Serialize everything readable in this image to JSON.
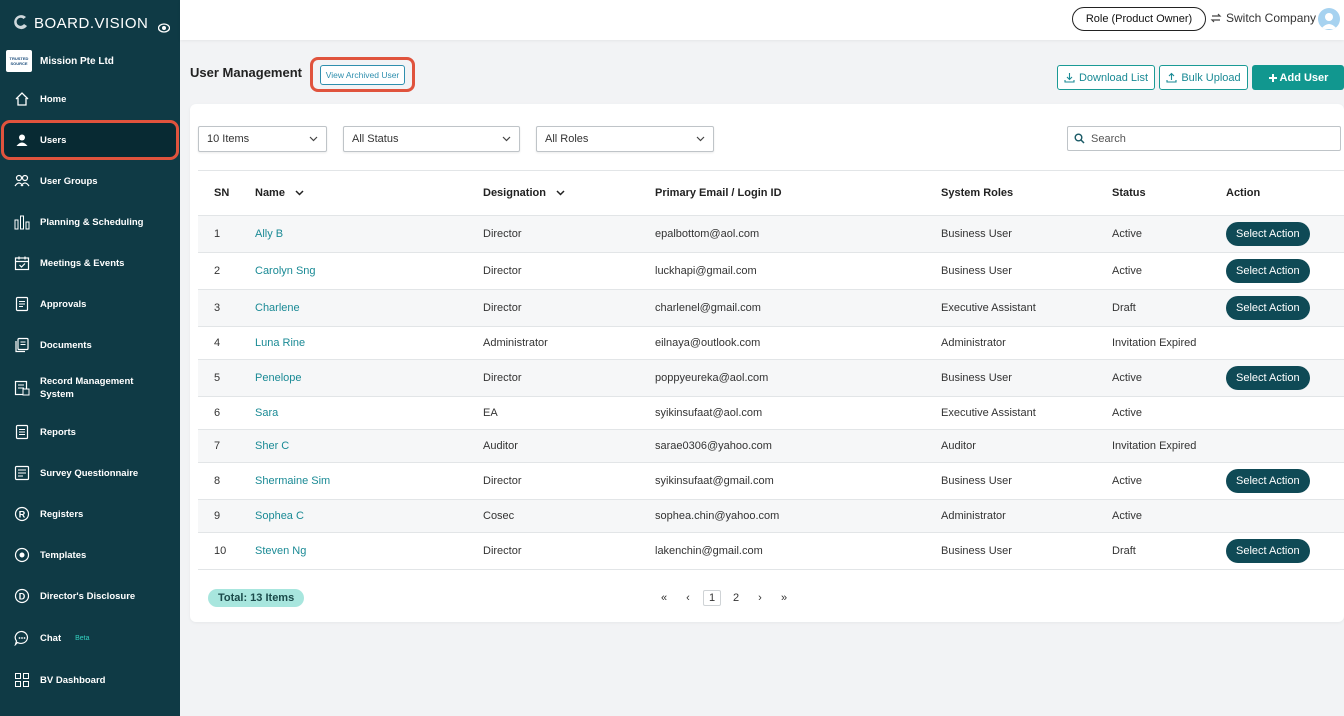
{
  "brand": {
    "name": "BOARD.VISION"
  },
  "company": {
    "logo_text": "TRUSTED SOURCE",
    "name": "Mission Pte Ltd"
  },
  "sidebar": {
    "items": [
      {
        "label": "Home",
        "icon": "home-icon"
      },
      {
        "label": "Users",
        "icon": "user-icon",
        "active": true
      },
      {
        "label": "User Groups",
        "icon": "user-group-icon"
      },
      {
        "label": "Planning & Scheduling",
        "icon": "chart-bars-icon"
      },
      {
        "label": "Meetings & Events",
        "icon": "calendar-icon"
      },
      {
        "label": "Approvals",
        "icon": "document-icon"
      },
      {
        "label": "Documents",
        "icon": "documents-icon"
      },
      {
        "label": "Record Management System",
        "icon": "record-icon"
      },
      {
        "label": "Reports",
        "icon": "report-icon"
      },
      {
        "label": "Survey Questionnaire",
        "icon": "survey-icon"
      },
      {
        "label": "Registers",
        "icon": "registered-icon"
      },
      {
        "label": "Templates",
        "icon": "template-icon"
      },
      {
        "label": "Director's Disclosure",
        "icon": "disclosure-icon"
      },
      {
        "label": "Chat",
        "icon": "chat-icon",
        "badge": "Beta"
      },
      {
        "label": "BV Dashboard",
        "icon": "dashboard-icon"
      }
    ]
  },
  "topbar": {
    "role_label": "Role (Product Owner)",
    "switch_label": "Switch Company"
  },
  "header": {
    "title": "User Management",
    "archived_label": "View Archived User",
    "download_label": "Download List",
    "bulk_label": "Bulk Upload",
    "add_label": "Add User"
  },
  "filters": {
    "items_value": "10 Items",
    "status_value": "All Status",
    "roles_value": "All Roles",
    "search_placeholder": "Search"
  },
  "table": {
    "columns": [
      "SN",
      "Name",
      "Designation",
      "Primary Email / Login ID",
      "System Roles",
      "Status",
      "Action"
    ],
    "rows": [
      {
        "sn": "1",
        "name": "Ally B",
        "designation": "Director",
        "email": "epalbottom@aol.com",
        "role": "Business User",
        "status": "Active",
        "action": "Select Action"
      },
      {
        "sn": "2",
        "name": "Carolyn Sng",
        "designation": "Director",
        "email": "luckhapi@gmail.com",
        "role": "Business User",
        "status": "Active",
        "action": "Select Action"
      },
      {
        "sn": "3",
        "name": "Charlene",
        "designation": "Director",
        "email": "charlenel@gmail.com",
        "role": "Executive Assistant",
        "status": "Draft",
        "action": "Select Action"
      },
      {
        "sn": "4",
        "name": "Luna Rine",
        "designation": "Administrator",
        "email": "eilnaya@outlook.com",
        "role": "Administrator",
        "status": "Invitation Expired",
        "action": ""
      },
      {
        "sn": "5",
        "name": "Penelope",
        "designation": "Director",
        "email": "poppyeureka@aol.com",
        "role": "Business User",
        "status": "Active",
        "action": "Select Action"
      },
      {
        "sn": "6",
        "name": "Sara",
        "designation": "EA",
        "email": "syikinsufaat@aol.com",
        "role": "Executive Assistant",
        "status": "Active",
        "action": ""
      },
      {
        "sn": "7",
        "name": "Sher C",
        "designation": "Auditor",
        "email": "sarae0306@yahoo.com",
        "role": "Auditor",
        "status": "Invitation Expired",
        "action": ""
      },
      {
        "sn": "8",
        "name": "Shermaine Sim",
        "designation": "Director",
        "email": "syikinsufaat@gmail.com",
        "role": "Business User",
        "status": "Active",
        "action": "Select Action"
      },
      {
        "sn": "9",
        "name": "Sophea C",
        "designation": "Cosec",
        "email": "sophea.chin@yahoo.com",
        "role": "Administrator",
        "status": "Active",
        "action": ""
      },
      {
        "sn": "10",
        "name": "Steven Ng",
        "designation": "Director",
        "email": "lakenchin@gmail.com",
        "role": "Business User",
        "status": "Draft",
        "action": "Select Action"
      }
    ]
  },
  "footer": {
    "total_label": "Total: 13 Items",
    "pages": [
      "1",
      "2"
    ],
    "current_page": "1"
  },
  "colors": {
    "sidebar": "#0f3a45",
    "accent": "#11978f",
    "highlight": "#e0533d",
    "action": "#0f4a56"
  }
}
